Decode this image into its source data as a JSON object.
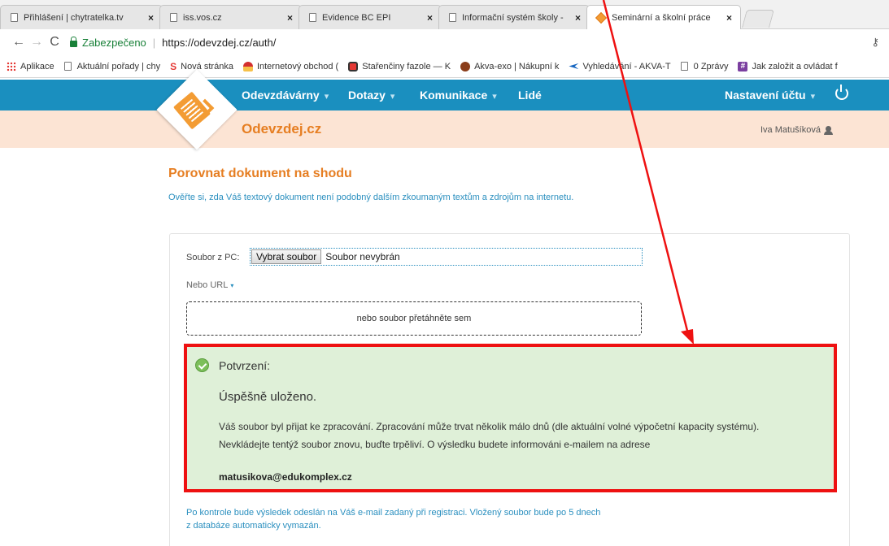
{
  "browser": {
    "tabs": [
      {
        "title": "Přihlášení | chytratelka.tv",
        "active": false
      },
      {
        "title": "iss.vos.cz",
        "active": false
      },
      {
        "title": "Evidence BC EPI",
        "active": false
      },
      {
        "title": "Informační systém školy -",
        "active": false
      },
      {
        "title": "Seminární a školní práce",
        "active": true
      }
    ],
    "tab_close": "×",
    "secure_label": "Zabezpečeno",
    "url": "https://odevzdej.cz/auth/",
    "nav": {
      "back": "←",
      "forward": "→",
      "reload": "C"
    },
    "key": "⚷",
    "bookmarks": [
      {
        "label": "Aplikace",
        "icon": "apps-icon"
      },
      {
        "label": "Aktuální pořady | chy",
        "icon": "page-icon"
      },
      {
        "label": "Nová stránka",
        "icon": "s-icon"
      },
      {
        "label": "Internetový obchod (",
        "icon": "hat-icon"
      },
      {
        "label": "Stařenčiny fazole — K",
        "icon": "bean-icon"
      },
      {
        "label": "Akva-exo | Nákupní k",
        "icon": "fish-icon"
      },
      {
        "label": "Vyhledávání - AKVA-T",
        "icon": "search-icon"
      },
      {
        "label": "0 Zprávy",
        "icon": "page-icon"
      },
      {
        "label": "Jak založit a ovládat f",
        "icon": "hash-icon"
      }
    ]
  },
  "site": {
    "nav": {
      "submissions": "Odevzdávárny",
      "questions": "Dotazy",
      "communication": "Komunikace",
      "people": "Lidé",
      "account": "Nastavení účtu",
      "caret": "▾"
    },
    "brand": "Odevzdej.cz",
    "user": "Iva Matušíková"
  },
  "main": {
    "title": "Porovnat dokument na shodu",
    "subtitle": "Ověřte si, zda Váš textový dokument není podobný dalším zkoumaným textům a zdrojům na internetu.",
    "file_label": "Soubor z PC:",
    "file_button": "Vybrat soubor",
    "file_status": "Soubor nevybrán",
    "url_toggle": "Nebo URL",
    "url_caret": "▾",
    "dropzone": "nebo soubor přetáhněte sem",
    "success": {
      "heading": "Potvrzení:",
      "title": "Úspěšně uloženo.",
      "line1": "Váš soubor byl přijat ke zpracování. Zpracování může trvat několik málo dnů (dle aktuální volné výpočetní kapacity systému).",
      "line2": "Nevkládejte tentýž soubor znovu, buďte trpěliví. O výsledku budete informováni e-mailem na adrese",
      "email": "matusikova@edukomplex.cz"
    },
    "note_line1": "Po kontrole bude výsledek odeslán na Váš e-mail zadaný při registraci. Vložený soubor bude po 5 dnech",
    "note_line2": "z databáze automaticky vymazán."
  },
  "colors": {
    "nav_blue": "#1a8fbf",
    "brand_orange": "#e67e22",
    "success_bg": "#dff0d8",
    "annotation_red": "#ee1111"
  }
}
